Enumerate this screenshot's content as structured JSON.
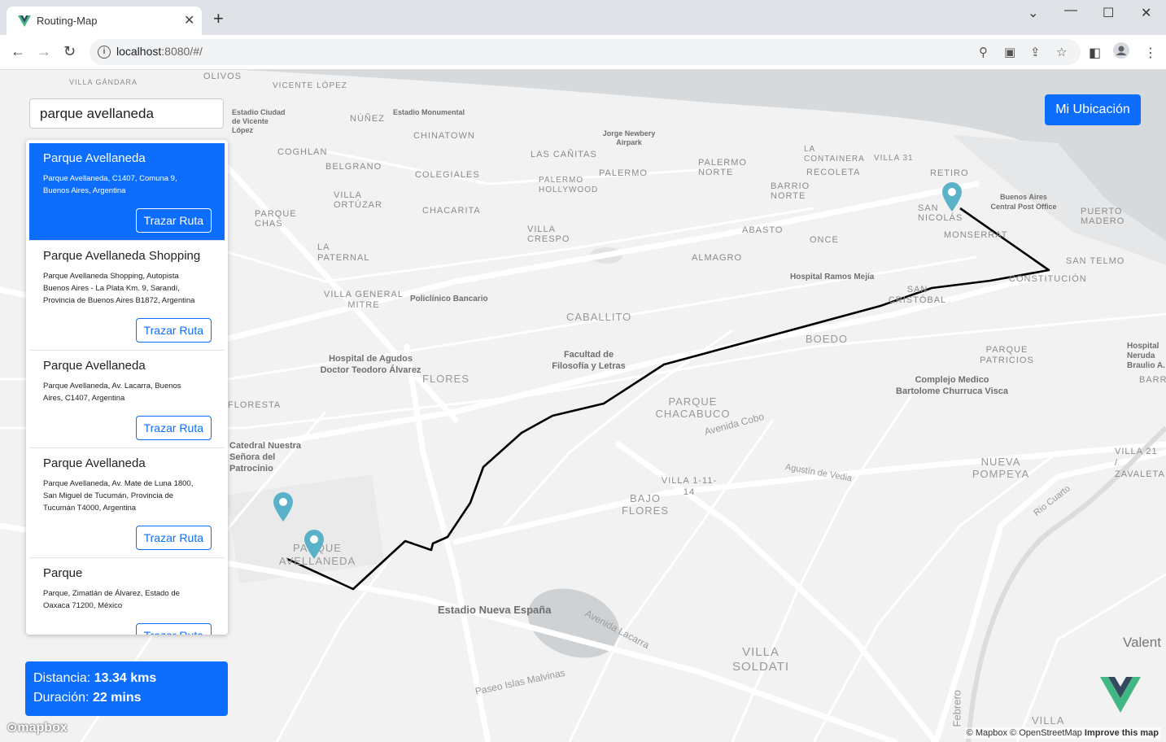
{
  "browser": {
    "tab_title": "Routing-Map",
    "tab_close": "✕",
    "new_tab": "+",
    "url_host": "localhost",
    "url_rest": ":8080/#/"
  },
  "search": {
    "value": "parque avellaneda"
  },
  "results": [
    {
      "title": "Parque Avellaneda",
      "address": "Parque Avellaneda, C1407, Comuna 9, Buenos Aires, Argentina",
      "button": "Trazar Ruta"
    },
    {
      "title": "Parque Avellaneda Shopping",
      "address": "Parque Avellaneda Shopping, Autopista Buenos Aires - La Plata Km. 9, Sarandí, Provincia de Buenos Aires B1872, Argentina",
      "button": "Trazar Ruta"
    },
    {
      "title": "Parque Avellaneda",
      "address": "Parque Avellaneda, Av. Lacarra, Buenos Aires, C1407, Argentina",
      "button": "Trazar Ruta"
    },
    {
      "title": "Parque Avellaneda",
      "address": "Parque Avellaneda, Av. Mate de Luna 1800, San Miguel de Tucumán, Provincia de Tucumán T4000, Argentina",
      "button": "Trazar Ruta"
    },
    {
      "title": "Parque",
      "address": "Parque, Zimatlán de Álvarez, Estado de Oaxaca 71200, México",
      "button": "Trazar Ruta"
    }
  ],
  "stats": {
    "distance_label": "Distancia:",
    "distance_value": "13.34 kms",
    "duration_label": "Duración:",
    "duration_value": "22 mins"
  },
  "my_location_button": "Mi Ubicación",
  "attribution": {
    "mapbox": "© Mapbox",
    "osm": "© OpenStreetMap",
    "improve": "Improve this map",
    "logo_text": "mapbox"
  },
  "map_labels": {
    "olivos": "OLIVOS",
    "villa_gandara": "VILLA GÁNDARA",
    "vicente_lopez": "VICENTE LÓPEZ",
    "nunez": "NÚÑEZ",
    "chinatown": "CHINATOWN",
    "coghlan": "COGHLAN",
    "belgrano": "BELGRANO",
    "colegiales": "COLEGIALES",
    "las_canitas": "LAS CAÑITAS",
    "palermo": "PALERMO",
    "palermo_norte": "PALERMO NORTE",
    "palermo_hollywood": "PALERMO HOLLYWOOD",
    "la_containera": "LA CONTAINERA",
    "recoleta": "RECOLETA",
    "villa31": "VILLA 31",
    "retiro": "RETIRO",
    "barrio_norte": "BARRIO NORTE",
    "villa_ortuzar": "VILLA ORTÚZAR",
    "chacarita": "CHACARITA",
    "parque_chas": "PARQUE CHAS",
    "villa_crespo": "VILLA CRESPO",
    "abasto": "ABASTO",
    "once": "ONCE",
    "monserrat": "MONSERRAT",
    "san_nicolas": "SAN NICOLÁS",
    "puerto_madero": "PUERTO MADERO",
    "san_telmo": "SAN TELMO",
    "constitucion": "CONSTITUCIÓN",
    "la_paternal": "LA PATERNAL",
    "almagro": "ALMAGRO",
    "villa_general_mitre": "VILLA GENERAL MITRE",
    "caballito": "CABALLITO",
    "san_cristobal": "SAN CRISTÓBAL",
    "boedo": "BOEDO",
    "parque_patricios": "PARQUE PATRICIOS",
    "barracas": "BARRACAS",
    "flores": "FLORES",
    "parque_chacabuco": "PARQUE CHACABUCO",
    "floresta": "FLORESTA",
    "nueva_pompeya": "NUEVA POMPEYA",
    "villa_1_11_14": "VILLA 1-11-14",
    "bajo_flores": "BAJO FLORES",
    "parque_avellaneda": "PARQUE AVELLANEDA",
    "villa_soldati": "VILLA SOLDATI",
    "villa21": "VILLA 21 / ZAVALETA",
    "villa_lugano": "VILLA",
    "estadio": "Estadio Nueva España",
    "aeroparque": "Jorge Newbery Airpark",
    "hospital_agudos": "Hospital de Agudos Doctor Teodoro Álvarez",
    "facultad": "Facultad de Filosofía y Letras",
    "hospital_ramos": "Hospital Ramos Mejía",
    "complejo": "Complejo Medico Bartolome Churruca Visca",
    "buenos_aires_post": "Buenos Aires Central Post Office",
    "estadio_monumental": "Estadio Monumental",
    "estadio_ciudad": "Estadio Ciudad de Vicente López",
    "policlinico": "Policlínico Bancario",
    "hospital_neruda": "Hospital Neruda Braulio A.",
    "nuestra_senora": "Catedral Nuestra Señora del Patrocinio",
    "valent": "Valent",
    "febrero": "Febrero",
    "av_cobo": "Avenida Cobo",
    "av_lacarra": "Avenida Lacarra",
    "paseo_islas": "Paseo Islas Malvinas",
    "agustin": "Agustín de Vedia",
    "riocuarto": "Río Cuarto"
  }
}
